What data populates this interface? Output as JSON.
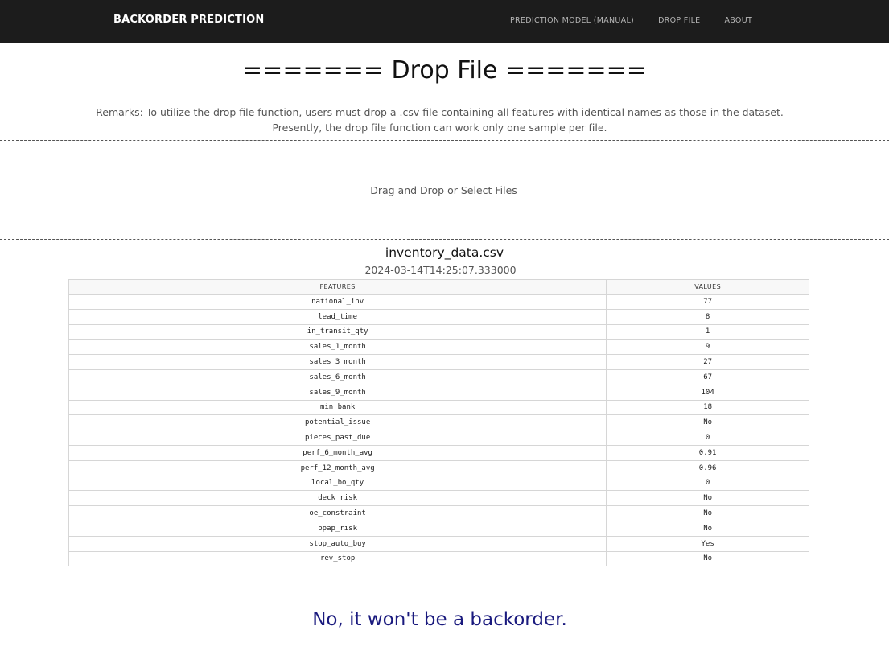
{
  "navbar": {
    "brand": "BACKORDER PREDICTION",
    "links": [
      "PREDICTION MODEL (MANUAL)",
      "DROP FILE",
      "ABOUT"
    ]
  },
  "page": {
    "title": "======= Drop File =======",
    "remarks_line1": "Remarks: To utilize the drop file function, users must drop a .csv file containing all features with identical names as those in the dataset.",
    "remarks_line2": "Presently, the drop file function can work only one sample per file."
  },
  "dropzone": {
    "text": "Drag and Drop or Select Files"
  },
  "file": {
    "name": "inventory_data.csv",
    "timestamp": "2024-03-14T14:25:07.333000"
  },
  "table": {
    "headers": [
      "FEATURES",
      "VALUES"
    ],
    "rows": [
      [
        "national_inv",
        "77"
      ],
      [
        "lead_time",
        "8"
      ],
      [
        "in_transit_qty",
        "1"
      ],
      [
        "sales_1_month",
        "9"
      ],
      [
        "sales_3_month",
        "27"
      ],
      [
        "sales_6_month",
        "67"
      ],
      [
        "sales_9_month",
        "104"
      ],
      [
        "min_bank",
        "18"
      ],
      [
        "potential_issue",
        "No"
      ],
      [
        "pieces_past_due",
        "0"
      ],
      [
        "perf_6_month_avg",
        "0.91"
      ],
      [
        "perf_12_month_avg",
        "0.96"
      ],
      [
        "local_bo_qty",
        "0"
      ],
      [
        "deck_risk",
        "No"
      ],
      [
        "oe_constraint",
        "No"
      ],
      [
        "ppap_risk",
        "No"
      ],
      [
        "stop_auto_buy",
        "Yes"
      ],
      [
        "rev_stop",
        "No"
      ]
    ]
  },
  "result": {
    "text": "No, it won't be a backorder.",
    "color": "#1a1a7e"
  },
  "colors": {
    "navbar_bg": "#1c1c1c",
    "nav_link": "#b5b5b5"
  }
}
